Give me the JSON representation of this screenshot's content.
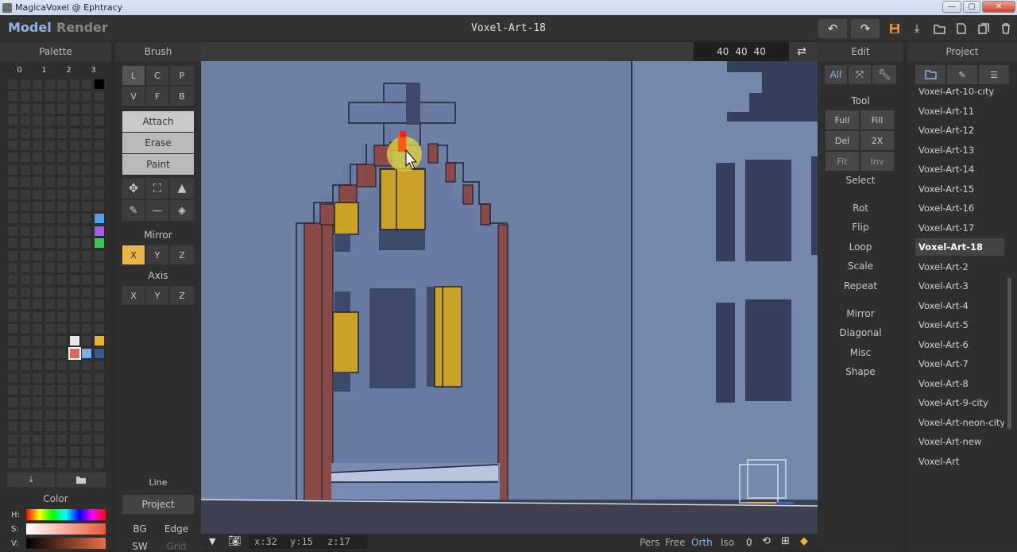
{
  "window": {
    "title": "MagicaVoxel @ Ephtracy",
    "min": "—",
    "max": "▢",
    "close": "✕"
  },
  "menubar": {
    "model": "Model",
    "render": "Render",
    "filename": "Voxel-Art-18"
  },
  "size": {
    "x": "40",
    "y": "40",
    "z": "40"
  },
  "palette": {
    "title": "Palette",
    "cols": [
      "0",
      "1",
      "2",
      "3"
    ],
    "color_title": "Color",
    "h": "H:",
    "s": "S:",
    "v": "V:"
  },
  "brush": {
    "title": "Brush",
    "types": [
      "L",
      "C",
      "P",
      "V",
      "F",
      "B"
    ],
    "modes": [
      "Attach",
      "Erase",
      "Paint"
    ],
    "mirror": "Mirror",
    "axis": "Axis",
    "axes": [
      "X",
      "Y",
      "Z"
    ],
    "line": "Line",
    "project": "Project",
    "bg": "BG",
    "edge": "Edge",
    "sw": "SW",
    "grid": "Grid"
  },
  "edit": {
    "title": "Edit",
    "all": "All",
    "tool": "Tool",
    "toolbtns": [
      "Full",
      "Fill",
      "Del",
      "2X",
      "Fit",
      "Inv"
    ],
    "items": [
      "Select",
      "Rot",
      "Flip",
      "Loop",
      "Scale",
      "Repeat",
      "Mirror",
      "Diagonal",
      "Misc",
      "Shape"
    ]
  },
  "project": {
    "title": "Project",
    "items": [
      "Voxel-Art-10-city",
      "Voxel-Art-11",
      "Voxel-Art-12",
      "Voxel-Art-13",
      "Voxel-Art-14",
      "Voxel-Art-15",
      "Voxel-Art-16",
      "Voxel-Art-17",
      "Voxel-Art-18",
      "Voxel-Art-2",
      "Voxel-Art-3",
      "Voxel-Art-4",
      "Voxel-Art-5",
      "Voxel-Art-6",
      "Voxel-Art-7",
      "Voxel-Art-8",
      "Voxel-Art-9-city",
      "Voxel-Art-neon-city",
      "Voxel-Art-new",
      "Voxel-Art"
    ],
    "selected": "Voxel-Art-18"
  },
  "status": {
    "x": "x:32",
    "y": "y:15",
    "z": "z:17",
    "pers": "Pers",
    "free": "Free",
    "orth": "Orth",
    "iso": "Iso",
    "zero": "0"
  },
  "colors": {
    "accent": "#e8b64a",
    "brick": "#8b4a48",
    "window_yellow": "#c9a227",
    "scene_bg": "#6e7fa6"
  }
}
